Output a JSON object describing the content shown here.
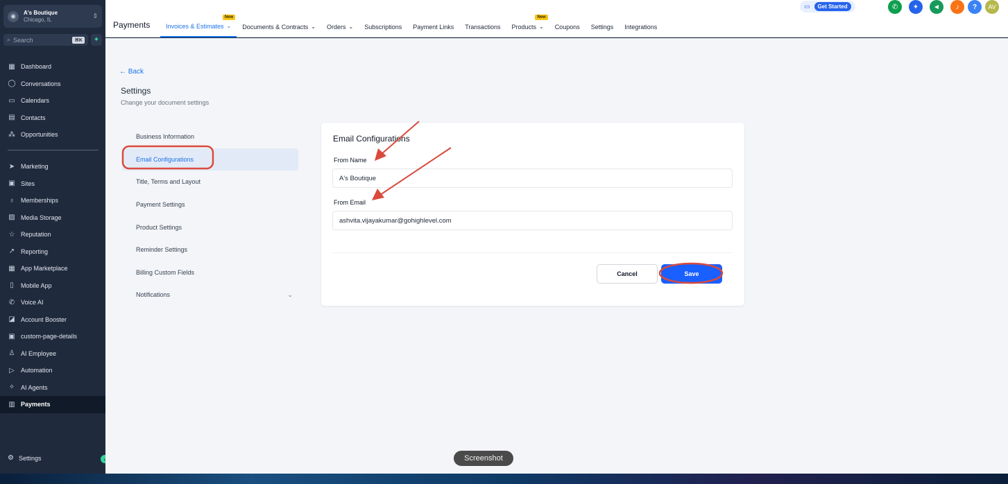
{
  "account": {
    "name": "A's Boutique",
    "location": "Chicago, IL"
  },
  "search": {
    "placeholder": "Search",
    "shortcut": "⌘K"
  },
  "sidebar": {
    "top_items": [
      {
        "label": "Dashboard",
        "icon": "dashboard-icon"
      },
      {
        "label": "Conversations",
        "icon": "chat-icon"
      },
      {
        "label": "Calendars",
        "icon": "calendar-icon"
      },
      {
        "label": "Contacts",
        "icon": "contacts-icon"
      },
      {
        "label": "Opportunities",
        "icon": "opportunities-icon"
      }
    ],
    "items": [
      {
        "label": "Marketing",
        "icon": "send-icon"
      },
      {
        "label": "Sites",
        "icon": "sites-icon"
      },
      {
        "label": "Memberships",
        "icon": "award-icon"
      },
      {
        "label": "Media Storage",
        "icon": "image-icon"
      },
      {
        "label": "Reputation",
        "icon": "star-icon"
      },
      {
        "label": "Reporting",
        "icon": "trend-icon"
      },
      {
        "label": "App Marketplace",
        "icon": "grid-icon"
      },
      {
        "label": "Mobile App",
        "icon": "phone-icon"
      },
      {
        "label": "Voice AI",
        "icon": "phone-call-icon"
      },
      {
        "label": "Account Booster",
        "icon": "booster-icon"
      },
      {
        "label": "custom-page-details",
        "icon": "page-icon"
      },
      {
        "label": "AI Employee",
        "icon": "user-icon"
      },
      {
        "label": "Automation",
        "icon": "play-icon"
      },
      {
        "label": "AI Agents",
        "icon": "sparkle-icon"
      },
      {
        "label": "Payments",
        "icon": "receipt-icon"
      }
    ],
    "settings_label": "Settings"
  },
  "header": {
    "title": "Payments",
    "tabs": [
      {
        "label": "Invoices & Estimates",
        "badge": "New",
        "chevron": true
      },
      {
        "label": "Documents & Contracts",
        "chevron": true
      },
      {
        "label": "Orders",
        "chevron": true
      },
      {
        "label": "Subscriptions"
      },
      {
        "label": "Payment Links"
      },
      {
        "label": "Transactions"
      },
      {
        "label": "Products",
        "badge": "New",
        "chevron": true
      },
      {
        "label": "Coupons"
      },
      {
        "label": "Settings"
      },
      {
        "label": "Integrations"
      }
    ],
    "get_started": "Get Started",
    "avatar_initials": "AV",
    "help_label": "?",
    "colors": {
      "phone": "#0e9f4e",
      "ai": "#2563eb",
      "megaphone": "#179a5b",
      "bell": "#f97316",
      "help": "#3b82f6",
      "avatar": "#b5b84a"
    }
  },
  "settings_page": {
    "back_label": "Back",
    "title": "Settings",
    "subtitle": "Change your document settings",
    "menu": [
      "Business Information",
      "Email Configurations",
      "Title, Terms and Layout",
      "Payment Settings",
      "Product Settings",
      "Reminder Settings",
      "Billing Custom Fields",
      "Notifications"
    ]
  },
  "email_config": {
    "title": "Email Configurations",
    "from_name_label": "From Name",
    "from_name_value": "A's Boutique",
    "from_email_label": "From Email",
    "from_email_value": "ashvita.vijayakumar@gohighlevel.com",
    "cancel_label": "Cancel",
    "save_label": "Save"
  },
  "tooltip": "Screenshot",
  "colors": {
    "accent": "#1a73e8",
    "save": "#1a5fff",
    "annotation": "#d94a3d",
    "sidebar": "#1f2a3d"
  }
}
